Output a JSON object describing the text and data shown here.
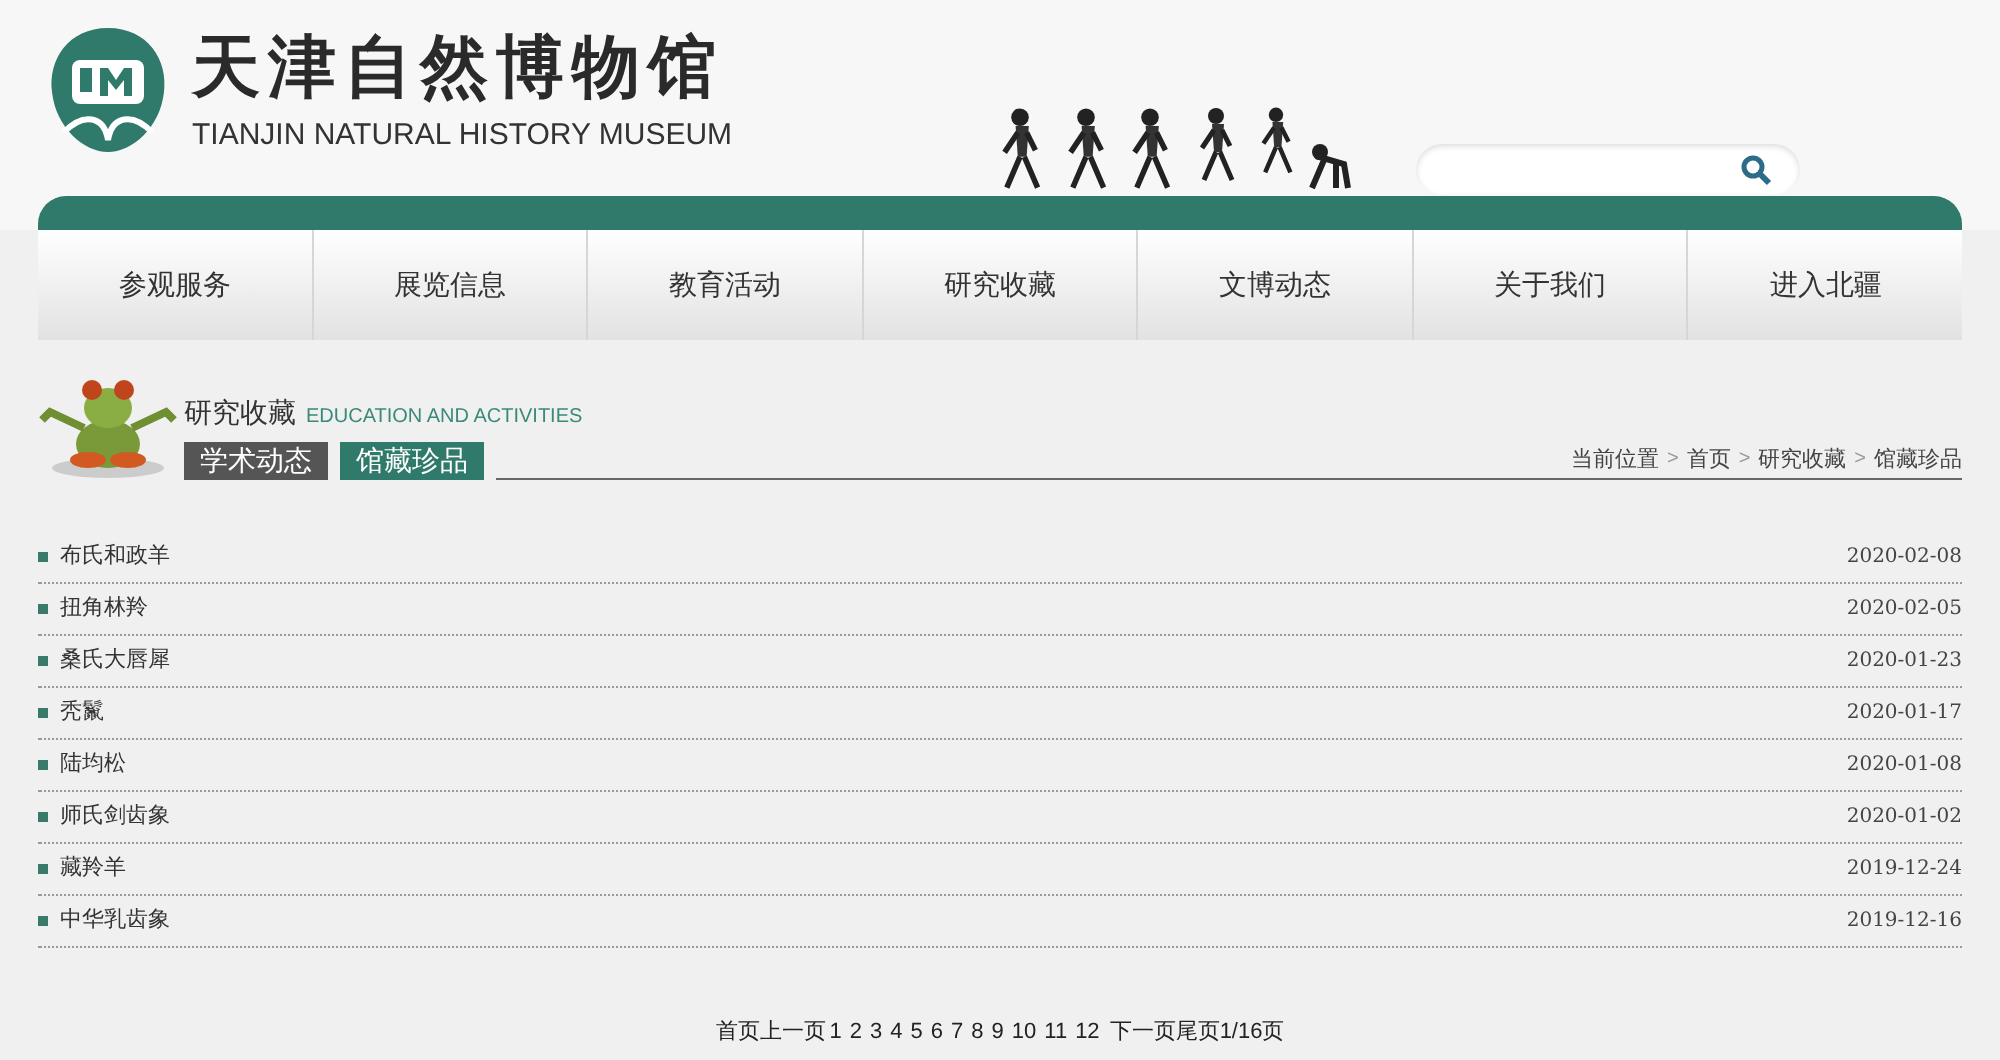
{
  "header": {
    "logo_title": "天津自然博物馆",
    "logo_subtitle": "TIANJIN NATURAL HISTORY MUSEUM"
  },
  "nav": [
    "参观服务",
    "展览信息",
    "教育活动",
    "研究收藏",
    "文博动态",
    "关于我们",
    "进入北疆"
  ],
  "section": {
    "title": "研究收藏",
    "subtitle": "EDUCATION AND ACTIVITIES",
    "tabs": [
      {
        "label": "学术动态",
        "selected": false
      },
      {
        "label": "馆藏珍品",
        "selected": true
      }
    ],
    "breadcrumb": {
      "items": [
        "当前位置",
        "首页",
        "研究收藏",
        "馆藏珍品"
      ],
      "separator": ">"
    }
  },
  "articles": [
    {
      "title": "布氏和政羊",
      "date": "2020-02-08"
    },
    {
      "title": "扭角林羚",
      "date": "2020-02-05"
    },
    {
      "title": "桑氏大唇犀",
      "date": "2020-01-23"
    },
    {
      "title": "秃鬣",
      "date": "2020-01-17"
    },
    {
      "title": "陆均松",
      "date": "2020-01-08"
    },
    {
      "title": "师氏剑齿象",
      "date": "2020-01-02"
    },
    {
      "title": "藏羚羊",
      "date": "2019-12-24"
    },
    {
      "title": "中华乳齿象",
      "date": "2019-12-16"
    }
  ],
  "pagination": {
    "first": "首页",
    "prev": "上一页",
    "pages": [
      "1",
      "2",
      "3",
      "4",
      "5",
      "6",
      "7",
      "8",
      "9",
      "10",
      "11",
      "12"
    ],
    "next": "下一页",
    "last": "尾页",
    "status": "1/16页"
  }
}
